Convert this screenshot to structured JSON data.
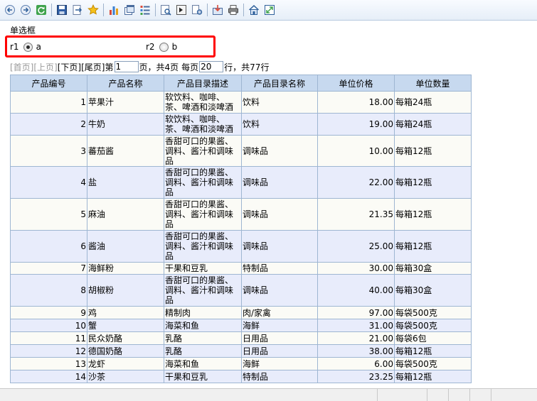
{
  "toolbar": {
    "icons": [
      "back-icon",
      "forward-icon",
      "refresh-icon",
      "save-icon",
      "export-icon",
      "favorite-icon",
      "chart-icon",
      "window-icon",
      "list-icon",
      "print-preview-icon",
      "exit-icon",
      "tools-icon",
      "import-icon",
      "print-icon",
      "home-icon",
      "resize-icon"
    ]
  },
  "form": {
    "caption": "单选框",
    "radio1": {
      "label": "r1",
      "option": "a",
      "checked": true
    },
    "radio2": {
      "label": "r2",
      "option": "b",
      "checked": false
    }
  },
  "pager": {
    "first": "[首页]",
    "prev": "[上页]",
    "next": "[下页]",
    "last": "[尾页]",
    "page_prefix": "第",
    "page_value": "1",
    "page_suffix": "页，共4页",
    "per_prefix": "每页",
    "per_value": "20",
    "per_suffix": "行，共77行"
  },
  "table": {
    "headers": [
      "产品编号",
      "产品名称",
      "产品目录描述",
      "产品目录名称",
      "单位价格",
      "单位数量"
    ],
    "rows": [
      {
        "id": "1",
        "name": "苹果汁",
        "desc": "软饮料、咖啡、茶、啤酒和淡啤酒",
        "cat": "饮料",
        "price": "18.00",
        "unit": "每箱24瓶"
      },
      {
        "id": "2",
        "name": "牛奶",
        "desc": "软饮料、咖啡、茶、啤酒和淡啤酒",
        "cat": "饮料",
        "price": "19.00",
        "unit": "每箱24瓶"
      },
      {
        "id": "3",
        "name": "蕃茄酱",
        "desc": "香甜可口的果酱、调料、酱汁和调味品",
        "cat": "调味品",
        "price": "10.00",
        "unit": "每箱12瓶"
      },
      {
        "id": "4",
        "name": "盐",
        "desc": "香甜可口的果酱、调料、酱汁和调味品",
        "cat": "调味品",
        "price": "22.00",
        "unit": "每箱12瓶"
      },
      {
        "id": "5",
        "name": "麻油",
        "desc": "香甜可口的果酱、调料、酱汁和调味品",
        "cat": "调味品",
        "price": "21.35",
        "unit": "每箱12瓶"
      },
      {
        "id": "6",
        "name": "酱油",
        "desc": "香甜可口的果酱、调料、酱汁和调味品",
        "cat": "调味品",
        "price": "25.00",
        "unit": "每箱12瓶"
      },
      {
        "id": "7",
        "name": "海鲜粉",
        "desc": "干果和豆乳",
        "cat": "特制品",
        "price": "30.00",
        "unit": "每箱30盒"
      },
      {
        "id": "8",
        "name": "胡椒粉",
        "desc": "香甜可口的果酱、调料、酱汁和调味品",
        "cat": "调味品",
        "price": "40.00",
        "unit": "每箱30盒"
      },
      {
        "id": "9",
        "name": "鸡",
        "desc": "精制肉",
        "cat": "肉/家禽",
        "price": "97.00",
        "unit": "每袋500克"
      },
      {
        "id": "10",
        "name": "蟹",
        "desc": "海菜和鱼",
        "cat": "海鲜",
        "price": "31.00",
        "unit": "每袋500克"
      },
      {
        "id": "11",
        "name": "民众奶酪",
        "desc": "乳酪",
        "cat": "日用品",
        "price": "21.00",
        "unit": "每袋6包"
      },
      {
        "id": "12",
        "name": "德国奶酪",
        "desc": "乳酪",
        "cat": "日用品",
        "price": "38.00",
        "unit": "每箱12瓶"
      },
      {
        "id": "13",
        "name": "龙虾",
        "desc": "海菜和鱼",
        "cat": "海鲜",
        "price": "6.00",
        "unit": "每袋500克"
      },
      {
        "id": "14",
        "name": "沙茶",
        "desc": "干果和豆乳",
        "cat": "特制品",
        "price": "23.25",
        "unit": "每箱12瓶"
      }
    ]
  }
}
